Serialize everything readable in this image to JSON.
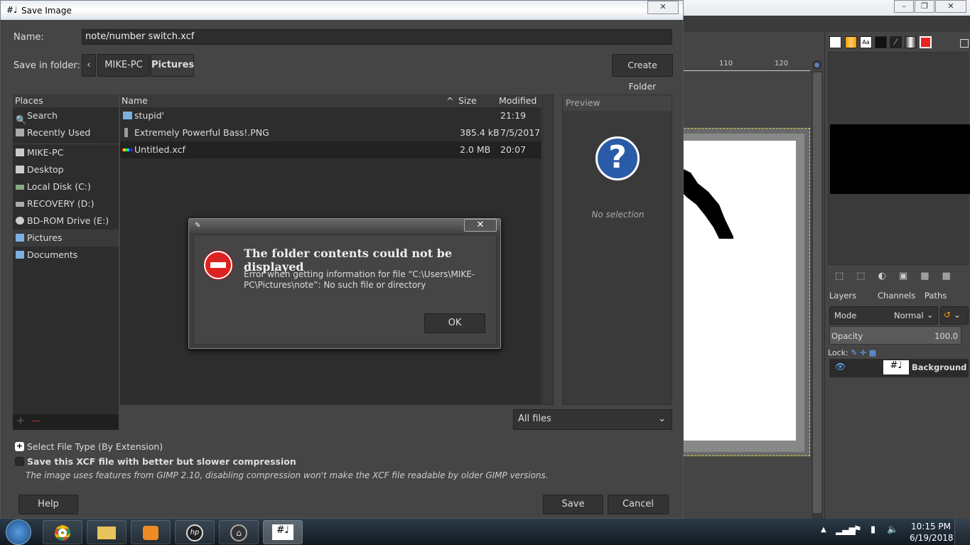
{
  "gimp": {
    "ruler_ticks": [
      "110",
      "120"
    ],
    "layers_tabs": [
      "Layers",
      "Channels",
      "Paths"
    ],
    "mode_label": "Mode",
    "mode_value": "Normal",
    "opacity_label": "Opacity",
    "opacity_value": "100.0",
    "lock_label": "Lock:",
    "layer_name": "Background"
  },
  "dialog": {
    "title": "Save Image",
    "name_label": "Name:",
    "name_value": "note/number switch.xcf",
    "folder_label": "Save in folder:",
    "breadcrumb": [
      "MIKE-PC",
      "Pictures"
    ],
    "create_folder": "Create Folder",
    "places_header": "Places",
    "places": [
      "Search",
      "Recently Used",
      "MIKE-PC",
      "Desktop",
      "Local Disk (C:)",
      "RECOVERY (D:)",
      "BD-ROM Drive (E:)",
      "Pictures",
      "Documents"
    ],
    "columns": {
      "name": "Name",
      "size": "Size",
      "modified": "Modified"
    },
    "files": [
      {
        "name": "stupid'",
        "size": "",
        "modified": "21:19"
      },
      {
        "name": "Extremely Powerful Bass!.PNG",
        "size": "385.4 kB",
        "modified": "7/5/2017"
      },
      {
        "name": "Untitled.xcf",
        "size": "2.0 MB",
        "modified": "20:07"
      }
    ],
    "preview_header": "Preview",
    "preview_empty": "No selection",
    "filter": "All files",
    "file_type": "Select File Type (By Extension)",
    "compress_label": "Save this XCF file with better but slower compression",
    "compress_note": "The image uses features from GIMP 2.10, disabling compression won't make the XCF file readable by older GIMP versions.",
    "help": "Help",
    "save": "Save",
    "cancel": "Cancel"
  },
  "error": {
    "title": "The folder contents could not be displayed",
    "message": "Error when getting information for file “C:\\Users\\MIKE-PC\\Pictures\\note”: No such file or directory",
    "ok": "OK"
  },
  "taskbar": {
    "time": "10:15 PM",
    "date": "6/19/2018"
  }
}
